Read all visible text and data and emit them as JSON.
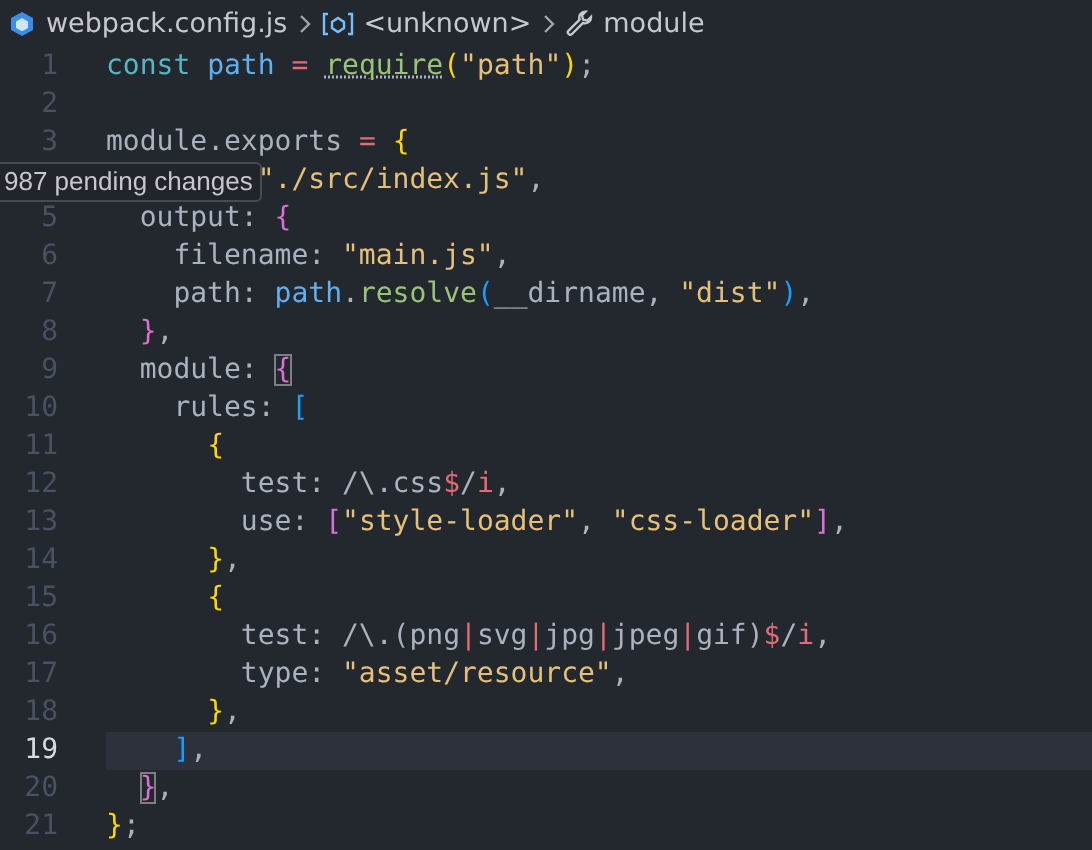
{
  "breadcrumbs": [
    {
      "kind": "file",
      "label": "webpack.config.js"
    },
    {
      "kind": "variable",
      "label": "<unknown>"
    },
    {
      "kind": "wrench",
      "label": "module"
    }
  ],
  "lines": [
    {
      "number": "1",
      "current": false,
      "tokens": [
        {
          "kind": "kw",
          "text": "const "
        },
        {
          "kind": "var",
          "text": "path"
        },
        {
          "kind": "op",
          "text": " = "
        },
        {
          "kind": "fn",
          "text": "require",
          "hint": true
        },
        {
          "kind": "b1",
          "text": "("
        },
        {
          "kind": "str",
          "text": "\"path\""
        },
        {
          "kind": "b1",
          "text": ")"
        },
        {
          "kind": "plain",
          "text": ";"
        }
      ]
    },
    {
      "number": "2",
      "current": false
    },
    {
      "number": "3",
      "current": false,
      "tokens": [
        {
          "kind": "plain",
          "text": "module.exports"
        },
        {
          "kind": "op",
          "text": " = "
        },
        {
          "kind": "b1",
          "text": "{"
        }
      ]
    },
    {
      "current": false,
      "covered": true,
      "tokens": [
        {
          "kind": "str",
          "text": "\"./src/index.js\""
        },
        {
          "kind": "plain",
          "text": ","
        }
      ]
    },
    {
      "number": "5",
      "current": false,
      "tokens": [
        {
          "kind": "plain",
          "text": "output: "
        },
        {
          "kind": "b2",
          "text": "{"
        }
      ]
    },
    {
      "number": "6",
      "current": false,
      "tokens": [
        {
          "kind": "plain",
          "text": "filename: "
        },
        {
          "kind": "str",
          "text": "\"main.js\""
        },
        {
          "kind": "plain",
          "text": ","
        }
      ]
    },
    {
      "number": "7",
      "current": false,
      "tokens": [
        {
          "kind": "plain",
          "text": "path: "
        },
        {
          "kind": "var",
          "text": "path"
        },
        {
          "kind": "plain",
          "text": "."
        },
        {
          "kind": "fn",
          "text": "resolve"
        },
        {
          "kind": "b3",
          "text": "("
        },
        {
          "kind": "plain",
          "text": "__dirname, "
        },
        {
          "kind": "str",
          "text": "\"dist\""
        },
        {
          "kind": "b3",
          "text": ")"
        },
        {
          "kind": "plain",
          "text": ","
        }
      ]
    },
    {
      "number": "8",
      "current": false,
      "tokens": [
        {
          "kind": "b2",
          "text": "}"
        },
        {
          "kind": "plain",
          "text": ","
        }
      ]
    },
    {
      "number": "9",
      "current": false,
      "tokens": [
        {
          "kind": "plain",
          "text": "module: "
        },
        {
          "kind": "b2",
          "text": "{",
          "matched": true
        }
      ]
    },
    {
      "number": "10",
      "current": false,
      "tokens": [
        {
          "kind": "plain",
          "text": "rules: "
        },
        {
          "kind": "b3",
          "text": "["
        }
      ]
    },
    {
      "number": "11",
      "current": false,
      "tokens": [
        {
          "kind": "b1",
          "text": "{"
        }
      ]
    },
    {
      "number": "12",
      "current": false,
      "tokens": [
        {
          "kind": "plain",
          "text": "test: /\\.css"
        },
        {
          "kind": "re",
          "text": "$"
        },
        {
          "kind": "plain",
          "text": "/"
        },
        {
          "kind": "re",
          "text": "i"
        },
        {
          "kind": "plain",
          "text": ","
        }
      ]
    },
    {
      "number": "13",
      "current": false,
      "tokens": [
        {
          "kind": "plain",
          "text": "use: "
        },
        {
          "kind": "b2",
          "text": "["
        },
        {
          "kind": "str",
          "text": "\"style-loader\""
        },
        {
          "kind": "plain",
          "text": ", "
        },
        {
          "kind": "str",
          "text": "\"css-loader\""
        },
        {
          "kind": "b2",
          "text": "]"
        },
        {
          "kind": "plain",
          "text": ","
        }
      ]
    },
    {
      "number": "14",
      "current": false,
      "tokens": [
        {
          "kind": "b1",
          "text": "}"
        },
        {
          "kind": "plain",
          "text": ","
        }
      ]
    },
    {
      "number": "15",
      "current": false,
      "tokens": [
        {
          "kind": "b1",
          "text": "{"
        }
      ]
    },
    {
      "number": "16",
      "current": false,
      "tokens": [
        {
          "kind": "plain",
          "text": "test: /\\.(png"
        },
        {
          "kind": "re",
          "text": "|"
        },
        {
          "kind": "plain",
          "text": "svg"
        },
        {
          "kind": "re",
          "text": "|"
        },
        {
          "kind": "plain",
          "text": "jpg"
        },
        {
          "kind": "re",
          "text": "|"
        },
        {
          "kind": "plain",
          "text": "jpeg"
        },
        {
          "kind": "re",
          "text": "|"
        },
        {
          "kind": "plain",
          "text": "gif)"
        },
        {
          "kind": "re",
          "text": "$"
        },
        {
          "kind": "plain",
          "text": "/"
        },
        {
          "kind": "re",
          "text": "i"
        },
        {
          "kind": "plain",
          "text": ","
        }
      ]
    },
    {
      "number": "17",
      "current": false,
      "tokens": [
        {
          "kind": "plain",
          "text": "type: "
        },
        {
          "kind": "str",
          "text": "\"asset/resource\""
        },
        {
          "kind": "plain",
          "text": ","
        }
      ]
    },
    {
      "number": "18",
      "current": false,
      "tokens": [
        {
          "kind": "b1",
          "text": "}"
        },
        {
          "kind": "plain",
          "text": ","
        }
      ]
    },
    {
      "number": "19",
      "current": true,
      "tokens": [
        {
          "kind": "b3",
          "text": "]"
        },
        {
          "kind": "plain",
          "text": ","
        }
      ]
    },
    {
      "number": "20",
      "current": false,
      "tokens": [
        {
          "kind": "b2",
          "text": "}",
          "matched": true
        },
        {
          "kind": "plain",
          "text": ","
        }
      ]
    },
    {
      "number": "21",
      "current": false,
      "tokens": [
        {
          "kind": "b1",
          "text": "}"
        },
        {
          "kind": "plain",
          "text": ";"
        }
      ]
    }
  ],
  "tooltip": "987 pending changes"
}
